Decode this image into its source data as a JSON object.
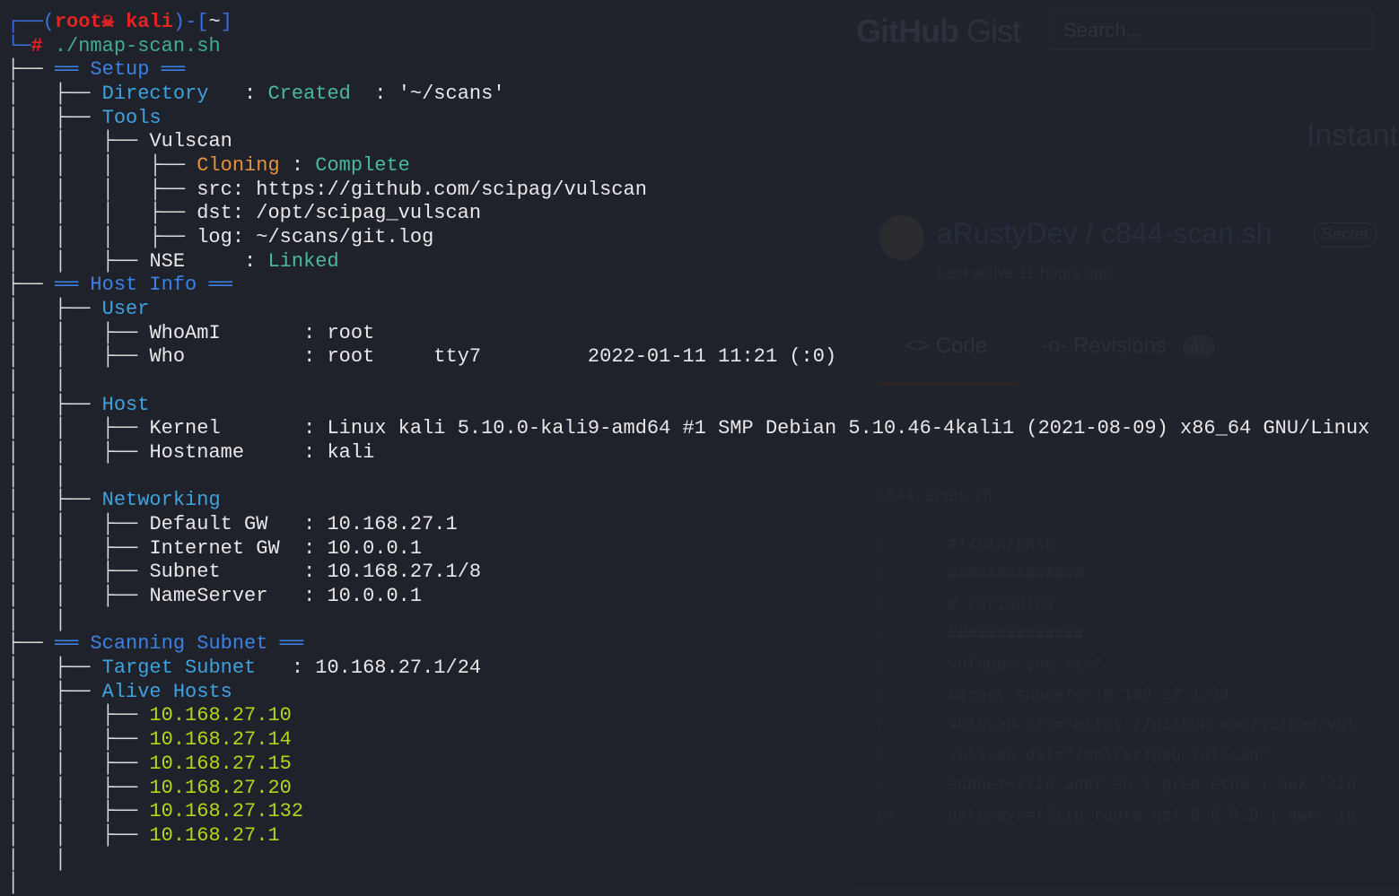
{
  "background_window": {
    "logo_bold": "GitHub",
    "logo_light": "Gist",
    "search_placeholder": "Search...",
    "heading": "Instant",
    "gist_title": "aRustyDev / c844-scan.sh",
    "visibility_badge": "Secret",
    "last_active": "Last active 11 hours ago",
    "tabs": [
      {
        "label": "<> Code"
      },
      {
        "label": "-o- Revisions"
      }
    ],
    "revisions_count": "47",
    "file_name": "c844-scan.sh",
    "code_lines": [
      "#!/bin/bash",
      "##############",
      "# Variables",
      "##############",
      "vulndb=\"cve.csv\"",
      "target_subnet=\"10.168.27.1/24\"",
      "vulscan_src=\"https://github.com/scipag/vul",
      "vulscan_dst=\"/opt/scipag_vulscan\"",
      "subnet=$(ip addr sh | grep eth0 | awk '/in",
      "gateways=($(ip route get 8.8.8.8 | awk '{p"
    ]
  },
  "colors": {
    "background": "#1f222b",
    "prompt_frame": "#3b6fe0",
    "prompt_user": "#e5231f",
    "section_heading": "#3b82e6",
    "label": "#3fa2dc",
    "status_ok": "#49b99e",
    "status_progress": "#e8913a",
    "alive_host": "#b5d41a"
  },
  "terminal": {
    "lines": [
      [
        [
          "b",
          "┌──("
        ],
        [
          "r",
          "root☠ kali"
        ],
        [
          "b",
          ")-["
        ],
        [
          "w",
          "~"
        ],
        [
          "b",
          "]"
        ]
      ],
      [
        [
          "b",
          "└─"
        ],
        [
          "r",
          "#"
        ],
        [
          "w",
          " "
        ],
        [
          "t",
          "./nmap-scan.sh"
        ]
      ],
      [
        [
          "p",
          "├── "
        ],
        [
          "h",
          "══ Setup ══"
        ]
      ],
      [
        [
          "p",
          "│   ├── "
        ],
        [
          "l",
          "Directory"
        ],
        [
          "w",
          "   : "
        ],
        [
          "g",
          "Created"
        ],
        [
          "w",
          "  : '~/scans'"
        ]
      ],
      [
        [
          "p",
          "│   ├── "
        ],
        [
          "l",
          "Tools"
        ]
      ],
      [
        [
          "p",
          "│   │   ├── "
        ],
        [
          "w",
          "Vulscan"
        ]
      ],
      [
        [
          "p",
          "│   │   │   ├── "
        ],
        [
          "o",
          "Cloning"
        ],
        [
          "w",
          " : "
        ],
        [
          "g",
          "Complete"
        ]
      ],
      [
        [
          "p",
          "│   │   │   ├── "
        ],
        [
          "w",
          "src: https://github.com/scipag/vulscan"
        ]
      ],
      [
        [
          "p",
          "│   │   │   ├── "
        ],
        [
          "w",
          "dst: /opt/scipag_vulscan"
        ]
      ],
      [
        [
          "p",
          "│   │   │   ├── "
        ],
        [
          "w",
          "log: ~/scans/git.log"
        ]
      ],
      [
        [
          "p",
          "│   │   ├── "
        ],
        [
          "w",
          "NSE"
        ],
        [
          "w",
          "     : "
        ],
        [
          "g",
          "Linked"
        ]
      ],
      [
        [
          "p",
          "├── "
        ],
        [
          "h",
          "══ Host Info ══"
        ]
      ],
      [
        [
          "p",
          "│   ├── "
        ],
        [
          "l",
          "User"
        ]
      ],
      [
        [
          "p",
          "│   │   ├── "
        ],
        [
          "w",
          "WhoAmI       : root"
        ]
      ],
      [
        [
          "p",
          "│   │   ├── "
        ],
        [
          "w",
          "Who          : root     tty7         2022-01-11 11:21 (:0)"
        ]
      ],
      [
        [
          "p",
          "│   │"
        ]
      ],
      [
        [
          "p",
          "│   ├── "
        ],
        [
          "l",
          "Host"
        ]
      ],
      [
        [
          "p",
          "│   │   ├── "
        ],
        [
          "w",
          "Kernel       : Linux kali 5.10.0-kali9-amd64 #1 SMP Debian 5.10.46-4kali1 (2021-08-09) x86_64 GNU/Linux"
        ]
      ],
      [
        [
          "p",
          "│   │   ├── "
        ],
        [
          "w",
          "Hostname     : kali"
        ]
      ],
      [
        [
          "p",
          "│   │"
        ]
      ],
      [
        [
          "p",
          "│   ├── "
        ],
        [
          "l",
          "Networking"
        ]
      ],
      [
        [
          "p",
          "│   │   ├── "
        ],
        [
          "w",
          "Default GW   : 10.168.27.1"
        ]
      ],
      [
        [
          "p",
          "│   │   ├── "
        ],
        [
          "w",
          "Internet GW  : 10.0.0.1"
        ]
      ],
      [
        [
          "p",
          "│   │   ├── "
        ],
        [
          "w",
          "Subnet       : 10.168.27.1/8"
        ]
      ],
      [
        [
          "p",
          "│   │   ├── "
        ],
        [
          "w",
          "NameServer   : 10.0.0.1"
        ]
      ],
      [
        [
          "p",
          "│   │"
        ]
      ],
      [
        [
          "p",
          "├── "
        ],
        [
          "h",
          "══ Scanning Subnet ══"
        ]
      ],
      [
        [
          "p",
          "│   ├── "
        ],
        [
          "l",
          "Target Subnet"
        ],
        [
          "w",
          "   : 10.168.27.1/24"
        ]
      ],
      [
        [
          "p",
          "│   ├── "
        ],
        [
          "l",
          "Alive Hosts"
        ]
      ],
      [
        [
          "p",
          "│   │   ├── "
        ],
        [
          "y",
          "10.168.27.10"
        ]
      ],
      [
        [
          "p",
          "│   │   ├── "
        ],
        [
          "y",
          "10.168.27.14"
        ]
      ],
      [
        [
          "p",
          "│   │   ├── "
        ],
        [
          "y",
          "10.168.27.15"
        ]
      ],
      [
        [
          "p",
          "│   │   ├── "
        ],
        [
          "y",
          "10.168.27.20"
        ]
      ],
      [
        [
          "p",
          "│   │   ├── "
        ],
        [
          "y",
          "10.168.27.132"
        ]
      ],
      [
        [
          "p",
          "│   │   ├── "
        ],
        [
          "y",
          "10.168.27.1"
        ]
      ],
      [
        [
          "p",
          "│   │"
        ]
      ],
      [
        [
          "p",
          "│"
        ]
      ]
    ]
  }
}
